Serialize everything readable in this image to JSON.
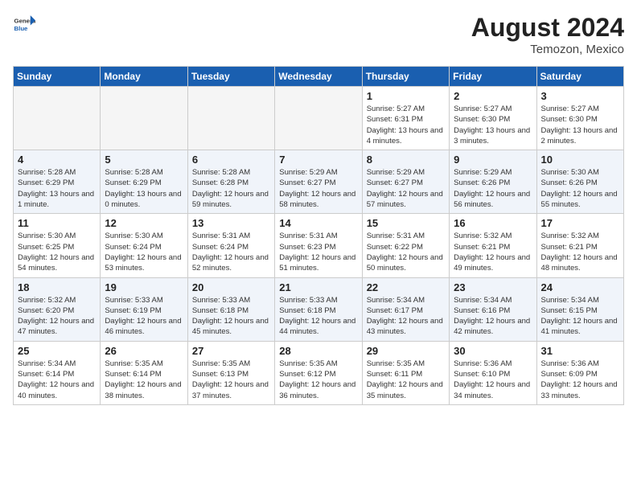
{
  "header": {
    "logo_general": "General",
    "logo_blue": "Blue",
    "month_year": "August 2024",
    "location": "Temozon, Mexico"
  },
  "days_of_week": [
    "Sunday",
    "Monday",
    "Tuesday",
    "Wednesday",
    "Thursday",
    "Friday",
    "Saturday"
  ],
  "weeks": [
    [
      {
        "day": "",
        "empty": true
      },
      {
        "day": "",
        "empty": true
      },
      {
        "day": "",
        "empty": true
      },
      {
        "day": "",
        "empty": true
      },
      {
        "day": "1",
        "sunrise": "5:27 AM",
        "sunset": "6:31 PM",
        "daylight": "13 hours and 4 minutes."
      },
      {
        "day": "2",
        "sunrise": "5:27 AM",
        "sunset": "6:30 PM",
        "daylight": "13 hours and 3 minutes."
      },
      {
        "day": "3",
        "sunrise": "5:27 AM",
        "sunset": "6:30 PM",
        "daylight": "13 hours and 2 minutes."
      }
    ],
    [
      {
        "day": "4",
        "sunrise": "5:28 AM",
        "sunset": "6:29 PM",
        "daylight": "13 hours and 1 minute."
      },
      {
        "day": "5",
        "sunrise": "5:28 AM",
        "sunset": "6:29 PM",
        "daylight": "13 hours and 0 minutes."
      },
      {
        "day": "6",
        "sunrise": "5:28 AM",
        "sunset": "6:28 PM",
        "daylight": "12 hours and 59 minutes."
      },
      {
        "day": "7",
        "sunrise": "5:29 AM",
        "sunset": "6:27 PM",
        "daylight": "12 hours and 58 minutes."
      },
      {
        "day": "8",
        "sunrise": "5:29 AM",
        "sunset": "6:27 PM",
        "daylight": "12 hours and 57 minutes."
      },
      {
        "day": "9",
        "sunrise": "5:29 AM",
        "sunset": "6:26 PM",
        "daylight": "12 hours and 56 minutes."
      },
      {
        "day": "10",
        "sunrise": "5:30 AM",
        "sunset": "6:26 PM",
        "daylight": "12 hours and 55 minutes."
      }
    ],
    [
      {
        "day": "11",
        "sunrise": "5:30 AM",
        "sunset": "6:25 PM",
        "daylight": "12 hours and 54 minutes."
      },
      {
        "day": "12",
        "sunrise": "5:30 AM",
        "sunset": "6:24 PM",
        "daylight": "12 hours and 53 minutes."
      },
      {
        "day": "13",
        "sunrise": "5:31 AM",
        "sunset": "6:24 PM",
        "daylight": "12 hours and 52 minutes."
      },
      {
        "day": "14",
        "sunrise": "5:31 AM",
        "sunset": "6:23 PM",
        "daylight": "12 hours and 51 minutes."
      },
      {
        "day": "15",
        "sunrise": "5:31 AM",
        "sunset": "6:22 PM",
        "daylight": "12 hours and 50 minutes."
      },
      {
        "day": "16",
        "sunrise": "5:32 AM",
        "sunset": "6:21 PM",
        "daylight": "12 hours and 49 minutes."
      },
      {
        "day": "17",
        "sunrise": "5:32 AM",
        "sunset": "6:21 PM",
        "daylight": "12 hours and 48 minutes."
      }
    ],
    [
      {
        "day": "18",
        "sunrise": "5:32 AM",
        "sunset": "6:20 PM",
        "daylight": "12 hours and 47 minutes."
      },
      {
        "day": "19",
        "sunrise": "5:33 AM",
        "sunset": "6:19 PM",
        "daylight": "12 hours and 46 minutes."
      },
      {
        "day": "20",
        "sunrise": "5:33 AM",
        "sunset": "6:18 PM",
        "daylight": "12 hours and 45 minutes."
      },
      {
        "day": "21",
        "sunrise": "5:33 AM",
        "sunset": "6:18 PM",
        "daylight": "12 hours and 44 minutes."
      },
      {
        "day": "22",
        "sunrise": "5:34 AM",
        "sunset": "6:17 PM",
        "daylight": "12 hours and 43 minutes."
      },
      {
        "day": "23",
        "sunrise": "5:34 AM",
        "sunset": "6:16 PM",
        "daylight": "12 hours and 42 minutes."
      },
      {
        "day": "24",
        "sunrise": "5:34 AM",
        "sunset": "6:15 PM",
        "daylight": "12 hours and 41 minutes."
      }
    ],
    [
      {
        "day": "25",
        "sunrise": "5:34 AM",
        "sunset": "6:14 PM",
        "daylight": "12 hours and 40 minutes."
      },
      {
        "day": "26",
        "sunrise": "5:35 AM",
        "sunset": "6:14 PM",
        "daylight": "12 hours and 38 minutes."
      },
      {
        "day": "27",
        "sunrise": "5:35 AM",
        "sunset": "6:13 PM",
        "daylight": "12 hours and 37 minutes."
      },
      {
        "day": "28",
        "sunrise": "5:35 AM",
        "sunset": "6:12 PM",
        "daylight": "12 hours and 36 minutes."
      },
      {
        "day": "29",
        "sunrise": "5:35 AM",
        "sunset": "6:11 PM",
        "daylight": "12 hours and 35 minutes."
      },
      {
        "day": "30",
        "sunrise": "5:36 AM",
        "sunset": "6:10 PM",
        "daylight": "12 hours and 34 minutes."
      },
      {
        "day": "31",
        "sunrise": "5:36 AM",
        "sunset": "6:09 PM",
        "daylight": "12 hours and 33 minutes."
      }
    ]
  ]
}
